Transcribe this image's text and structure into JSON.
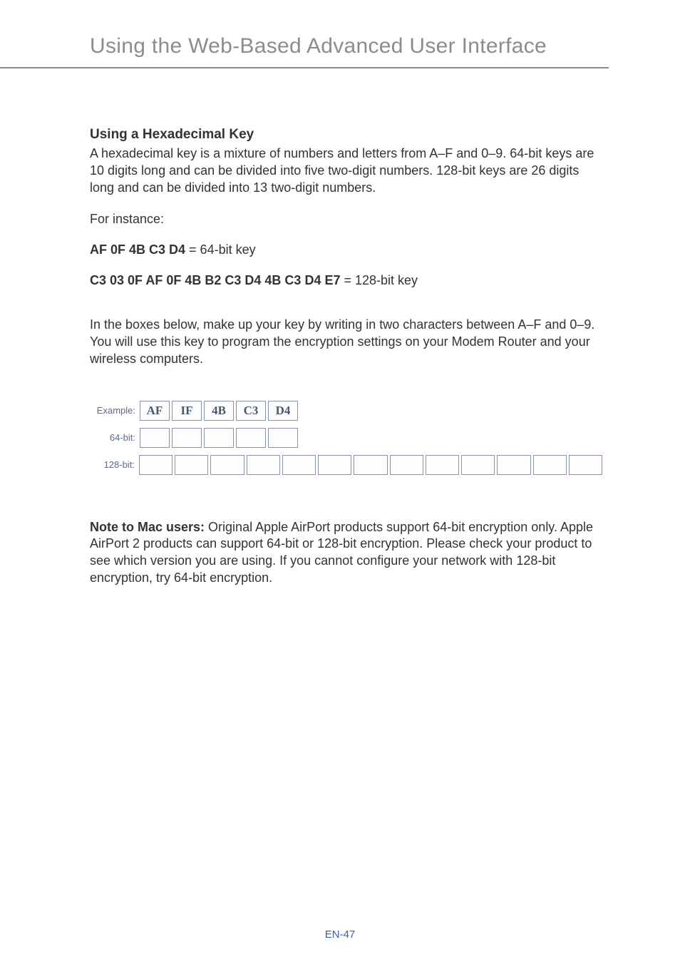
{
  "header": {
    "title": "Using the Web-Based Advanced User Interface"
  },
  "section": {
    "heading": "Using a Hexadecimal Key",
    "intro": "A hexadecimal key is a mixture of numbers and letters from A–F and 0–9. 64-bit keys are 10 digits long and can be divided into five two-digit numbers. 128-bit keys are 26 digits long and can be divided into 13 two-digit numbers.",
    "for_instance": "For instance:",
    "key64_bold": "AF 0F 4B C3 D4",
    "key64_suffix": " = 64-bit key",
    "key128_bold": "C3 03 0F AF 0F 4B B2 C3 D4 4B C3 D4 E7",
    "key128_suffix": " = 128-bit key",
    "instructions": "In the boxes below, make up your key by writing in two characters between A–F and 0–9. You will use this key to program the encryption settings on your Modem Router and your wireless computers."
  },
  "key_table": {
    "labels": {
      "example": "Example:",
      "bit64": "64-bit:",
      "bit128": "128-bit:"
    },
    "example_values": [
      "AF",
      "IF",
      "4B",
      "C3",
      "D4"
    ],
    "bit64_count": 5,
    "bit128_count": 13
  },
  "note": {
    "bold": "Note to Mac users:",
    "text": " Original Apple AirPort products support 64-bit encryption only. Apple AirPort 2 products can support 64-bit or 128-bit encryption. Please check your product to see which version you are using. If you cannot configure your network with 128-bit encryption, try 64-bit encryption."
  },
  "footer": {
    "page": "EN-47"
  }
}
